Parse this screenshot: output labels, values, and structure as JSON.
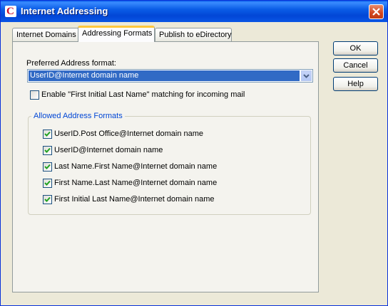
{
  "window": {
    "title": "Internet Addressing",
    "app_icon_letter": "C"
  },
  "tabs": [
    {
      "label": "Internet Domains"
    },
    {
      "label": "Addressing Formats"
    },
    {
      "label": "Publish to eDirectory"
    }
  ],
  "preferred": {
    "label": "Preferred Address format:",
    "selected": "UserID@Internet domain name"
  },
  "enable_matching": {
    "label": "Enable \"First Initial Last Name\" matching for incoming mail",
    "checked": false
  },
  "allowed": {
    "title": "Allowed Address Formats",
    "items": [
      {
        "label": "UserID.Post Office@Internet domain name",
        "checked": true
      },
      {
        "label": "UserID@Internet domain name",
        "checked": true
      },
      {
        "label": "Last Name.First Name@Internet domain name",
        "checked": true
      },
      {
        "label": "First Name.Last Name@Internet domain name",
        "checked": true
      },
      {
        "label": "First Initial Last Name@Internet domain name",
        "checked": true
      }
    ]
  },
  "buttons": {
    "ok": "OK",
    "cancel": "Cancel",
    "help": "Help"
  },
  "colors": {
    "titlebar": "#0A56E4",
    "selection": "#316AC5",
    "group_title": "#0046D5",
    "active_tab_accent": "#FFC73C"
  }
}
